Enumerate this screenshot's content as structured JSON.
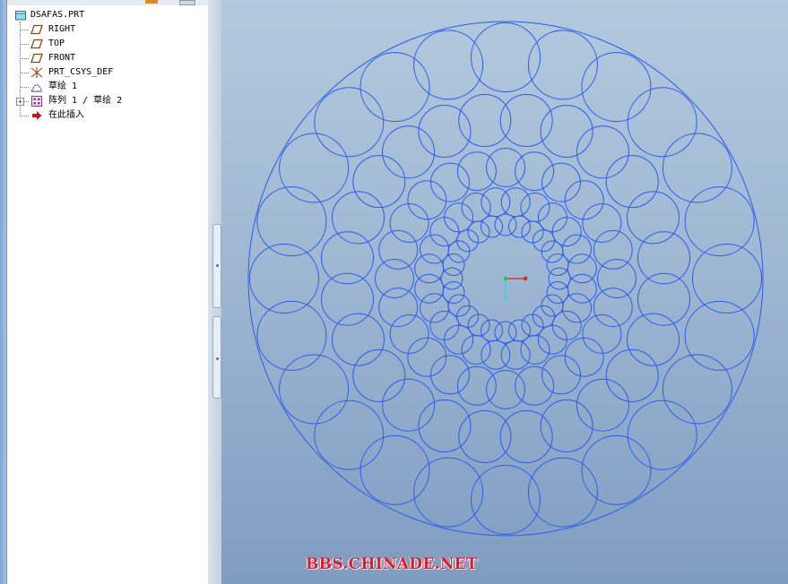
{
  "model_tree": {
    "root": {
      "label": "DSAFAS.PRT",
      "icon": "part-icon"
    },
    "items": [
      {
        "label": "RIGHT",
        "icon": "datum-plane-icon"
      },
      {
        "label": "TOP",
        "icon": "datum-plane-icon"
      },
      {
        "label": "FRONT",
        "icon": "datum-plane-icon"
      },
      {
        "label": "PRT_CSYS_DEF",
        "icon": "coordinate-system-icon"
      },
      {
        "label": "草绘 1",
        "icon": "sketch-icon"
      },
      {
        "label": "阵列 1 / 草绘 2",
        "icon": "pattern-icon"
      },
      {
        "label": "在此插入",
        "icon": "insert-here-arrow-icon"
      }
    ]
  },
  "viewport": {
    "watermark": "BBS.CHINADE.NET",
    "colors": {
      "sketch": "#2a5cf0",
      "csys_x": "#e02020",
      "csys_y": "#20c040",
      "csys_z": "#40d0e0"
    }
  }
}
